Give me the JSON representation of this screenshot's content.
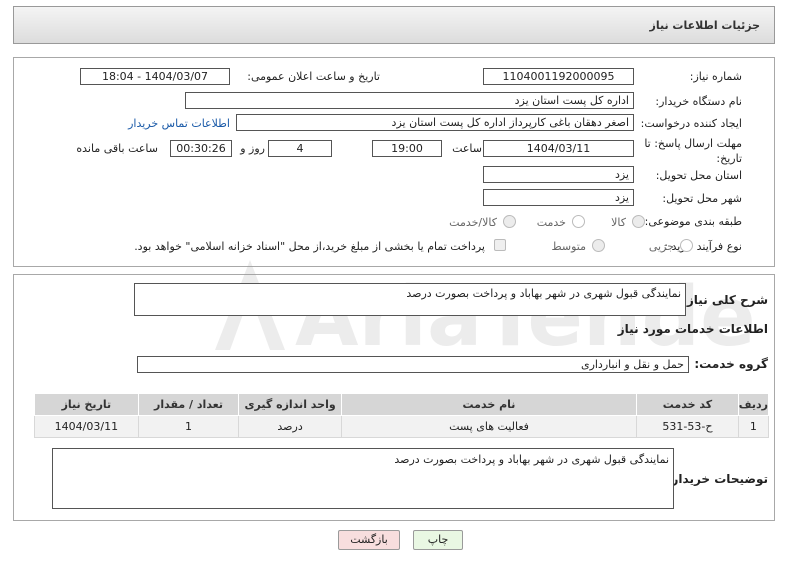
{
  "header": {
    "title": "جزئیات اطلاعات نیاز"
  },
  "form": {
    "need_number_label": "شماره نیاز:",
    "need_number": "1104001192000095",
    "announce_label": "تاریخ و ساعت اعلان عمومی:",
    "announce_value": "1404/03/07 - 18:04",
    "buyer_org_label": "نام دستگاه خریدار:",
    "buyer_org": "اداره کل پست استان یزد",
    "requester_label": "ایجاد کننده درخواست:",
    "requester": "اصغر دهقان باغی کارپرداز اداره کل پست استان یزد",
    "contact_link": "اطلاعات تماس خریدار",
    "deadline_label": "مهلت ارسال پاسخ: تا تاریخ:",
    "deadline_date": "1404/03/11",
    "time_label": "ساعت",
    "deadline_time": "19:00",
    "days_value": "4",
    "days_label": "روز و",
    "remaining_value": "00:30:26",
    "remaining_label": "ساعت باقی مانده",
    "province_label": "استان محل تحویل:",
    "province": "یزد",
    "city_label": "شهر محل تحویل:",
    "city": "یزد",
    "category_label": "طبقه بندی موضوعی:",
    "category_options": [
      "کالا",
      "خدمت",
      "کالا/خدمت"
    ],
    "category_selected": "خدمت",
    "process_label": "نوع فرآیند خرید :",
    "process_options": [
      "جزیی",
      "متوسط"
    ],
    "process_selected": "جزیی",
    "treasury_note": "پرداخت تمام یا بخشی از مبلغ خرید،از محل \"اسناد خزانه اسلامی\" خواهد بود."
  },
  "description": {
    "label": "شرح کلی نیاز:",
    "value": "نمایندگی قبول شهری در شهر بهاباد و پرداخت بصورت درصد"
  },
  "services": {
    "section_title": "اطلاعات خدمات مورد نیاز",
    "group_label": "گروه خدمت:",
    "group_value": "حمل و نقل و انبارداری",
    "columns": [
      "ردیف",
      "کد خدمت",
      "نام خدمت",
      "واحد اندازه گیری",
      "تعداد / مقدار",
      "تاریخ نیاز"
    ],
    "rows": [
      [
        "1",
        "ح-53-531",
        "فعالیت های پست",
        "درصد",
        "1",
        "1404/03/11"
      ]
    ]
  },
  "buyer_notes": {
    "label": "توضیحات خریدار:",
    "value": "نمایندگی قبول شهری در شهر بهاباد و پرداخت بصورت درصد"
  },
  "buttons": {
    "print": "چاپ",
    "back": "بازگشت"
  },
  "watermark": {
    "text": "AriaTender.net"
  },
  "colors": {
    "link": "#1a5aa8",
    "back_button": "#f8dede",
    "print_button": "#e9f7e3"
  }
}
